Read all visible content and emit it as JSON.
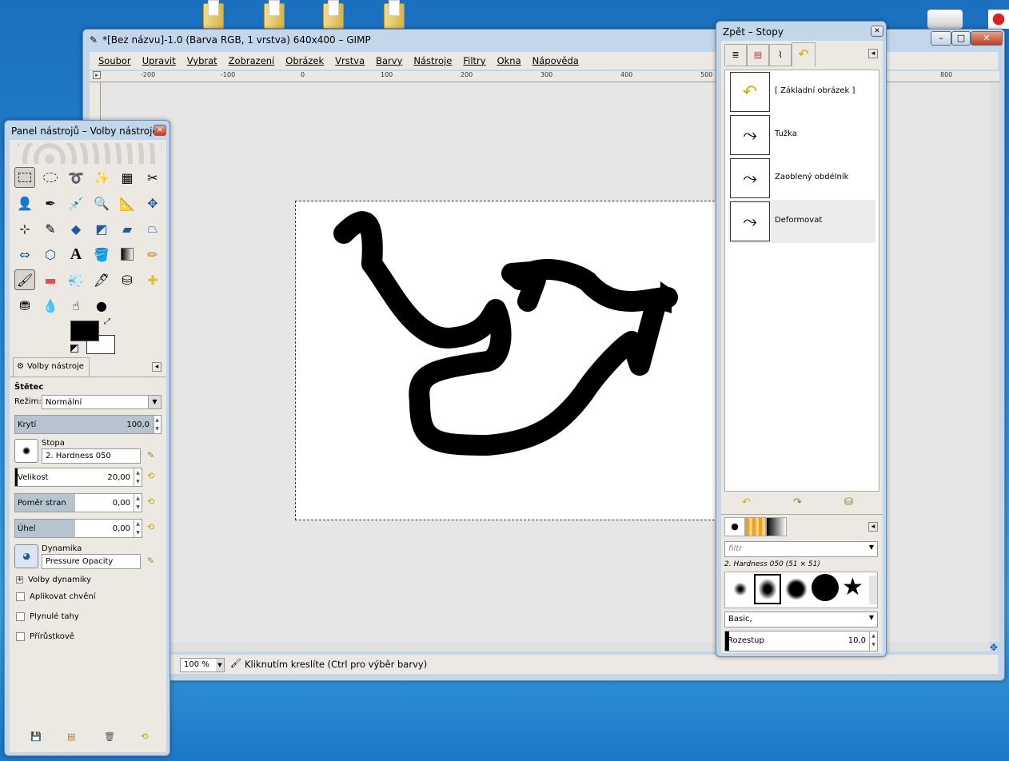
{
  "main_window": {
    "title": "*[Bez názvu]-1.0 (Barva RGB, 1 vrstva) 640x400 – GIMP",
    "menu": [
      "Soubor",
      "Upravit",
      "Vybrat",
      "Zobrazení",
      "Obrázek",
      "Vrstva",
      "Barvy",
      "Nástroje",
      "Filtry",
      "Okna",
      "Nápověda"
    ],
    "ruler_ticks": [
      "-200",
      "-100",
      "0",
      "100",
      "200",
      "300",
      "400",
      "500",
      "800"
    ],
    "status": {
      "zoom": "100 %",
      "message": "Kliknutím kreslíte (Ctrl pro výběr barvy)"
    }
  },
  "toolbox": {
    "title": "Panel nástrojů – Volby nástroje",
    "tab_label": "Volby nástroje",
    "tool_name": "Štětec",
    "mode_label": "Režim:",
    "mode_value": "Normální",
    "opacity": {
      "label": "Krytí",
      "value": "100,0",
      "fraction": 1.0
    },
    "brush": {
      "label": "Stopa",
      "value": "2. Hardness 050"
    },
    "size": {
      "label": "Velikost",
      "value": "20,00",
      "fraction": 0.02
    },
    "aspect": {
      "label": "Poměr stran",
      "value": "0,00",
      "fraction": 0.5
    },
    "angle": {
      "label": "Úhel",
      "value": "0,00",
      "fraction": 0.5
    },
    "dynamics": {
      "label": "Dynamika",
      "value": "Pressure Opacity"
    },
    "dynamics_options": "Volby dynamiky",
    "checks": [
      "Aplikovat chvění",
      "Plynulé tahy",
      "Přírůstkově"
    ]
  },
  "dock": {
    "title": "Zpět – Stopy",
    "undo_items": [
      {
        "label": "[ Základní obrázek ]",
        "icon": "undo-arrow-icon"
      },
      {
        "label": "Tužka",
        "icon": "path-icon"
      },
      {
        "label": "Zaoblený obdélník",
        "icon": "path-icon"
      },
      {
        "label": "Deformovat",
        "icon": "path-icon"
      }
    ],
    "filter_placeholder": "filtr",
    "brush_info": "2. Hardness 050 (51 × 51)",
    "tag_value": "Basic,",
    "spacing": {
      "label": "Rozestup",
      "value": "10,0",
      "fraction": 0.05
    }
  },
  "colors": {
    "accent": "#ffd200",
    "selection": "#ffcc00",
    "foreground": "#000000",
    "background": "#ffffff"
  }
}
